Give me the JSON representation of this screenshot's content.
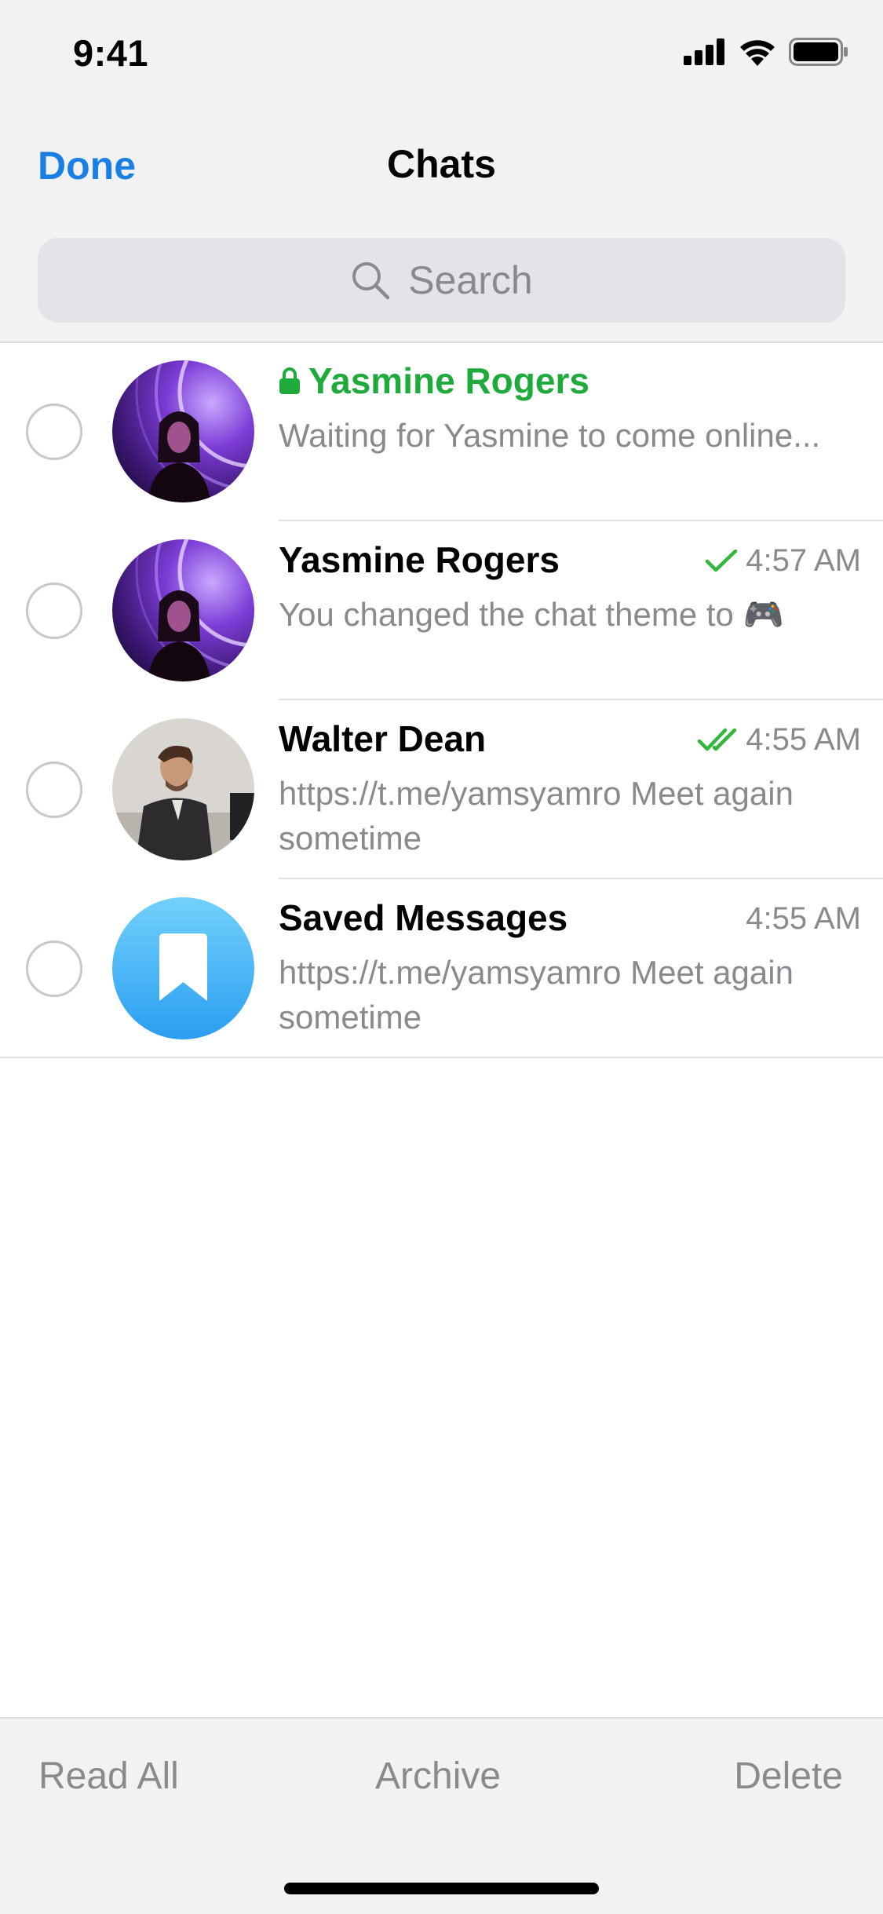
{
  "status_bar": {
    "time": "9:41"
  },
  "nav": {
    "done_label": "Done",
    "title": "Chats"
  },
  "search": {
    "placeholder": "Search"
  },
  "chats": [
    {
      "name": "Yasmine Rogers",
      "secret": true,
      "time": "",
      "preview": "Waiting for Yasmine to come online...",
      "avatar": "photo-woman-purple"
    },
    {
      "name": "Yasmine Rogers",
      "secret": false,
      "time": "4:57 AM",
      "check": "single",
      "preview": "You changed the chat theme to 🎮",
      "avatar": "photo-woman-purple"
    },
    {
      "name": "Walter Dean",
      "secret": false,
      "time": "4:55 AM",
      "check": "double",
      "preview": "https://t.me/yamsyamro Meet again sometime",
      "avatar": "photo-man-suit"
    },
    {
      "name": "Saved Messages",
      "secret": false,
      "time": "4:55 AM",
      "preview": "https://t.me/yamsyamro Meet again sometime",
      "avatar": "bookmark-icon"
    }
  ],
  "toolbar": {
    "read_all": "Read All",
    "archive": "Archive",
    "delete": "Delete"
  },
  "colors": {
    "accent": "#1a7fe3",
    "secret_green": "#1eab3c",
    "check_green": "#2fb83a",
    "muted": "#8a8a8e"
  }
}
